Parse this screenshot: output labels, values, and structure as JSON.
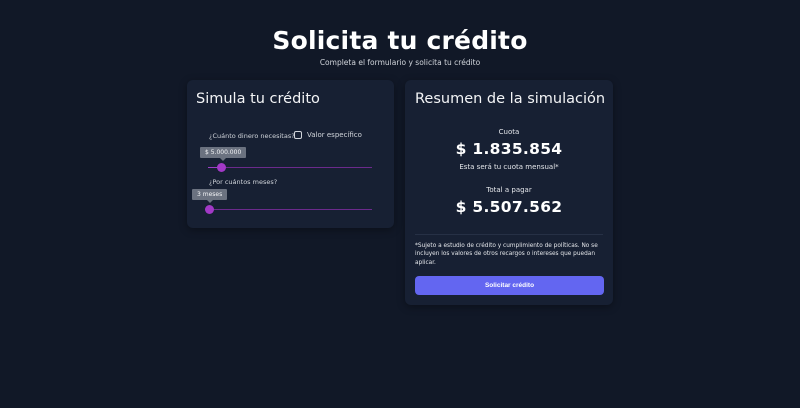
{
  "header": {
    "title": "Solicita tu crédito",
    "subtitle": "Completa el formulario y solicita tu crédito"
  },
  "simulator": {
    "title": "Simula tu crédito",
    "amount_label": "¿Cuánto dinero necesitas?",
    "specific_value_label": "Valor específico",
    "specific_value_checked": false,
    "amount_value": "$ 5.000.000",
    "amount_slider_fraction": 0.08,
    "months_label": "¿Por cuántos meses?",
    "months_value": "3 meses",
    "months_slider_fraction": 0.0,
    "accent_color": "#a239c7"
  },
  "summary": {
    "title": "Resumen de la simulación",
    "installment_label": "Cuota",
    "installment_value": "$ 1.835.854",
    "installment_note": "Esta será tu cuota mensual*",
    "total_label": "Total a pagar",
    "total_value": "$ 5.507.562",
    "disclaimer": "*Sujeto a estudio de crédito y cumplimiento de políticas. No se incluyen los valores de otros recargos o intereses que puedan aplicar.",
    "cta_label": "Solicitar crédito",
    "cta_color": "#6366f1"
  }
}
